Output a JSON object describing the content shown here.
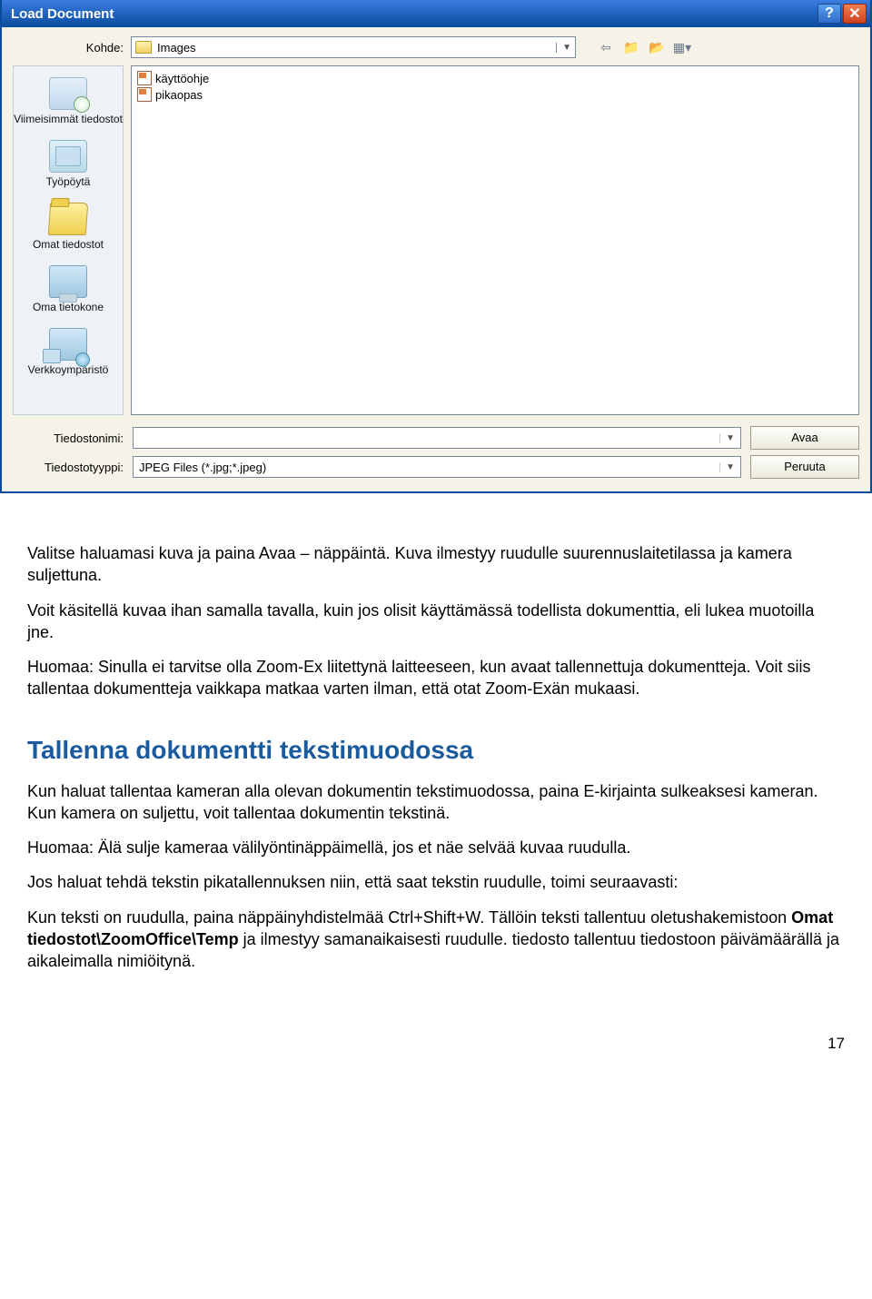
{
  "dialog": {
    "title": "Load Document",
    "kohde_label": "Kohde:",
    "kohde_value": "Images",
    "places": [
      {
        "key": "recent",
        "label": "Viimeisimmät tiedostot"
      },
      {
        "key": "desktop",
        "label": "Työpöytä"
      },
      {
        "key": "documents",
        "label": "Omat tiedostot"
      },
      {
        "key": "computer",
        "label": "Oma tietokone"
      },
      {
        "key": "network",
        "label": "Verkkoympäristö"
      }
    ],
    "files": [
      "käyttöohje",
      "pikaopas"
    ],
    "filename_label": "Tiedostonimi:",
    "filename_value": "",
    "filetype_label": "Tiedostotyyppi:",
    "filetype_value": "JPEG Files (*.jpg;*.jpeg)",
    "open_btn": "Avaa",
    "cancel_btn": "Peruuta"
  },
  "body": {
    "p1": "Valitse haluamasi kuva ja paina Avaa – näppäintä. Kuva ilmestyy ruudulle suurennuslaitetilassa ja kamera suljettuna.",
    "p2": "Voit käsitellä kuvaa ihan samalla tavalla, kuin jos olisit käyttämässä todellista dokumenttia, eli lukea muotoilla jne.",
    "p3": "Huomaa: Sinulla ei tarvitse olla Zoom-Ex liitettynä laitteeseen, kun avaat tallennettuja dokumentteja. Voit siis tallentaa dokumentteja vaikkapa matkaa varten ilman, että otat Zoom-Exän mukaasi.",
    "h2": "Tallenna dokumentti tekstimuodossa",
    "p4": "Kun haluat tallentaa kameran alla olevan dokumentin tekstimuodossa, paina E-kirjainta sulkeaksesi kameran. Kun kamera on suljettu, voit tallentaa dokumentin tekstinä.",
    "p5": "Huomaa: Älä sulje kameraa välilyöntinäppäimellä, jos et näe selvää kuvaa ruudulla.",
    "p6": "Jos haluat tehdä tekstin pikatallennuksen niin, että saat tekstin ruudulle, toimi seuraavasti:",
    "p7a": "Kun teksti on ruudulla, paina näppäinyhdistelmää Ctrl+Shift+W. Tällöin teksti tallentuu oletushakemistoon ",
    "p7b": "Omat tiedostot\\ZoomOffice\\Temp",
    "p7c": " ja ilmestyy samanaikaisesti ruudulle. tiedosto tallentuu tiedostoon päivämäärällä ja aikaleimalla nimiöitynä.",
    "page": "17"
  }
}
